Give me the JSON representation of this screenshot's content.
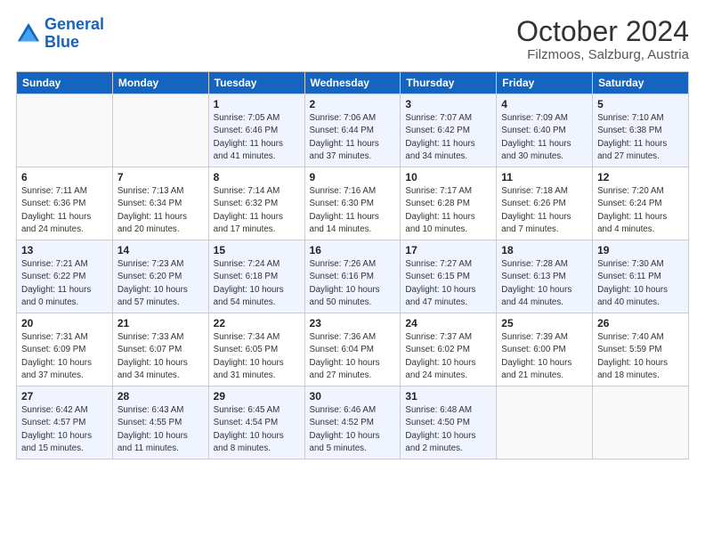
{
  "header": {
    "logo_line1": "General",
    "logo_line2": "Blue",
    "month": "October 2024",
    "location": "Filzmoos, Salzburg, Austria"
  },
  "weekdays": [
    "Sunday",
    "Monday",
    "Tuesday",
    "Wednesday",
    "Thursday",
    "Friday",
    "Saturday"
  ],
  "weeks": [
    [
      {
        "day": "",
        "info": ""
      },
      {
        "day": "",
        "info": ""
      },
      {
        "day": "1",
        "info": "Sunrise: 7:05 AM\nSunset: 6:46 PM\nDaylight: 11 hours and 41 minutes."
      },
      {
        "day": "2",
        "info": "Sunrise: 7:06 AM\nSunset: 6:44 PM\nDaylight: 11 hours and 37 minutes."
      },
      {
        "day": "3",
        "info": "Sunrise: 7:07 AM\nSunset: 6:42 PM\nDaylight: 11 hours and 34 minutes."
      },
      {
        "day": "4",
        "info": "Sunrise: 7:09 AM\nSunset: 6:40 PM\nDaylight: 11 hours and 30 minutes."
      },
      {
        "day": "5",
        "info": "Sunrise: 7:10 AM\nSunset: 6:38 PM\nDaylight: 11 hours and 27 minutes."
      }
    ],
    [
      {
        "day": "6",
        "info": "Sunrise: 7:11 AM\nSunset: 6:36 PM\nDaylight: 11 hours and 24 minutes."
      },
      {
        "day": "7",
        "info": "Sunrise: 7:13 AM\nSunset: 6:34 PM\nDaylight: 11 hours and 20 minutes."
      },
      {
        "day": "8",
        "info": "Sunrise: 7:14 AM\nSunset: 6:32 PM\nDaylight: 11 hours and 17 minutes."
      },
      {
        "day": "9",
        "info": "Sunrise: 7:16 AM\nSunset: 6:30 PM\nDaylight: 11 hours and 14 minutes."
      },
      {
        "day": "10",
        "info": "Sunrise: 7:17 AM\nSunset: 6:28 PM\nDaylight: 11 hours and 10 minutes."
      },
      {
        "day": "11",
        "info": "Sunrise: 7:18 AM\nSunset: 6:26 PM\nDaylight: 11 hours and 7 minutes."
      },
      {
        "day": "12",
        "info": "Sunrise: 7:20 AM\nSunset: 6:24 PM\nDaylight: 11 hours and 4 minutes."
      }
    ],
    [
      {
        "day": "13",
        "info": "Sunrise: 7:21 AM\nSunset: 6:22 PM\nDaylight: 11 hours and 0 minutes."
      },
      {
        "day": "14",
        "info": "Sunrise: 7:23 AM\nSunset: 6:20 PM\nDaylight: 10 hours and 57 minutes."
      },
      {
        "day": "15",
        "info": "Sunrise: 7:24 AM\nSunset: 6:18 PM\nDaylight: 10 hours and 54 minutes."
      },
      {
        "day": "16",
        "info": "Sunrise: 7:26 AM\nSunset: 6:16 PM\nDaylight: 10 hours and 50 minutes."
      },
      {
        "day": "17",
        "info": "Sunrise: 7:27 AM\nSunset: 6:15 PM\nDaylight: 10 hours and 47 minutes."
      },
      {
        "day": "18",
        "info": "Sunrise: 7:28 AM\nSunset: 6:13 PM\nDaylight: 10 hours and 44 minutes."
      },
      {
        "day": "19",
        "info": "Sunrise: 7:30 AM\nSunset: 6:11 PM\nDaylight: 10 hours and 40 minutes."
      }
    ],
    [
      {
        "day": "20",
        "info": "Sunrise: 7:31 AM\nSunset: 6:09 PM\nDaylight: 10 hours and 37 minutes."
      },
      {
        "day": "21",
        "info": "Sunrise: 7:33 AM\nSunset: 6:07 PM\nDaylight: 10 hours and 34 minutes."
      },
      {
        "day": "22",
        "info": "Sunrise: 7:34 AM\nSunset: 6:05 PM\nDaylight: 10 hours and 31 minutes."
      },
      {
        "day": "23",
        "info": "Sunrise: 7:36 AM\nSunset: 6:04 PM\nDaylight: 10 hours and 27 minutes."
      },
      {
        "day": "24",
        "info": "Sunrise: 7:37 AM\nSunset: 6:02 PM\nDaylight: 10 hours and 24 minutes."
      },
      {
        "day": "25",
        "info": "Sunrise: 7:39 AM\nSunset: 6:00 PM\nDaylight: 10 hours and 21 minutes."
      },
      {
        "day": "26",
        "info": "Sunrise: 7:40 AM\nSunset: 5:59 PM\nDaylight: 10 hours and 18 minutes."
      }
    ],
    [
      {
        "day": "27",
        "info": "Sunrise: 6:42 AM\nSunset: 4:57 PM\nDaylight: 10 hours and 15 minutes."
      },
      {
        "day": "28",
        "info": "Sunrise: 6:43 AM\nSunset: 4:55 PM\nDaylight: 10 hours and 11 minutes."
      },
      {
        "day": "29",
        "info": "Sunrise: 6:45 AM\nSunset: 4:54 PM\nDaylight: 10 hours and 8 minutes."
      },
      {
        "day": "30",
        "info": "Sunrise: 6:46 AM\nSunset: 4:52 PM\nDaylight: 10 hours and 5 minutes."
      },
      {
        "day": "31",
        "info": "Sunrise: 6:48 AM\nSunset: 4:50 PM\nDaylight: 10 hours and 2 minutes."
      },
      {
        "day": "",
        "info": ""
      },
      {
        "day": "",
        "info": ""
      }
    ]
  ]
}
